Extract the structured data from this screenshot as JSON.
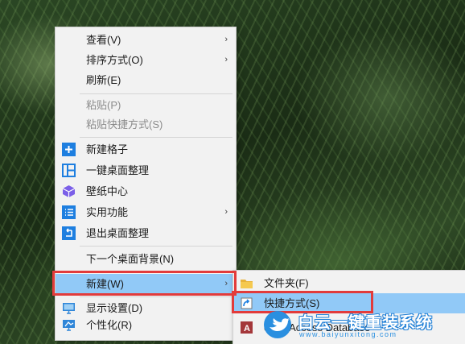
{
  "context_menu": {
    "items": [
      {
        "label": "查看(V)",
        "has_submenu": true
      },
      {
        "label": "排序方式(O)",
        "has_submenu": true
      },
      {
        "label": "刷新(E)"
      },
      {
        "label": "粘贴(P)",
        "disabled": true
      },
      {
        "label": "粘贴快捷方式(S)",
        "disabled": true
      },
      {
        "label": "新建格子",
        "icon": "plus-square-icon"
      },
      {
        "label": "一键桌面整理",
        "icon": "layout-grid-icon"
      },
      {
        "label": "壁纸中心",
        "icon": "wallpaper-cube-icon"
      },
      {
        "label": "实用功能",
        "icon": "list-icon",
        "has_submenu": true
      },
      {
        "label": "退出桌面整理",
        "icon": "exit-icon"
      },
      {
        "label": "下一个桌面背景(N)"
      },
      {
        "label": "新建(W)",
        "has_submenu": true,
        "highlighted": true
      },
      {
        "label": "显示设置(D)",
        "icon": "monitor-icon"
      },
      {
        "label": "个性化(R)",
        "icon": "personalize-icon"
      }
    ],
    "submenu_arrow": "›"
  },
  "new_submenu": {
    "items": [
      {
        "label": "文件夹(F)",
        "icon": "folder-icon"
      },
      {
        "label": "快捷方式(S)",
        "icon": "shortcut-icon",
        "highlighted": true
      },
      {
        "label": "osoft Access Database",
        "icon": "access-icon"
      }
    ]
  },
  "watermark": {
    "text": "白云一键重装系统",
    "subtext": "www.baiyunxitong.com"
  },
  "colors": {
    "highlight": "#91c9f7",
    "annotation_box": "#e23b3b",
    "icon_blue": "#1e7fe0",
    "menu_bg": "#f2f2f2"
  }
}
